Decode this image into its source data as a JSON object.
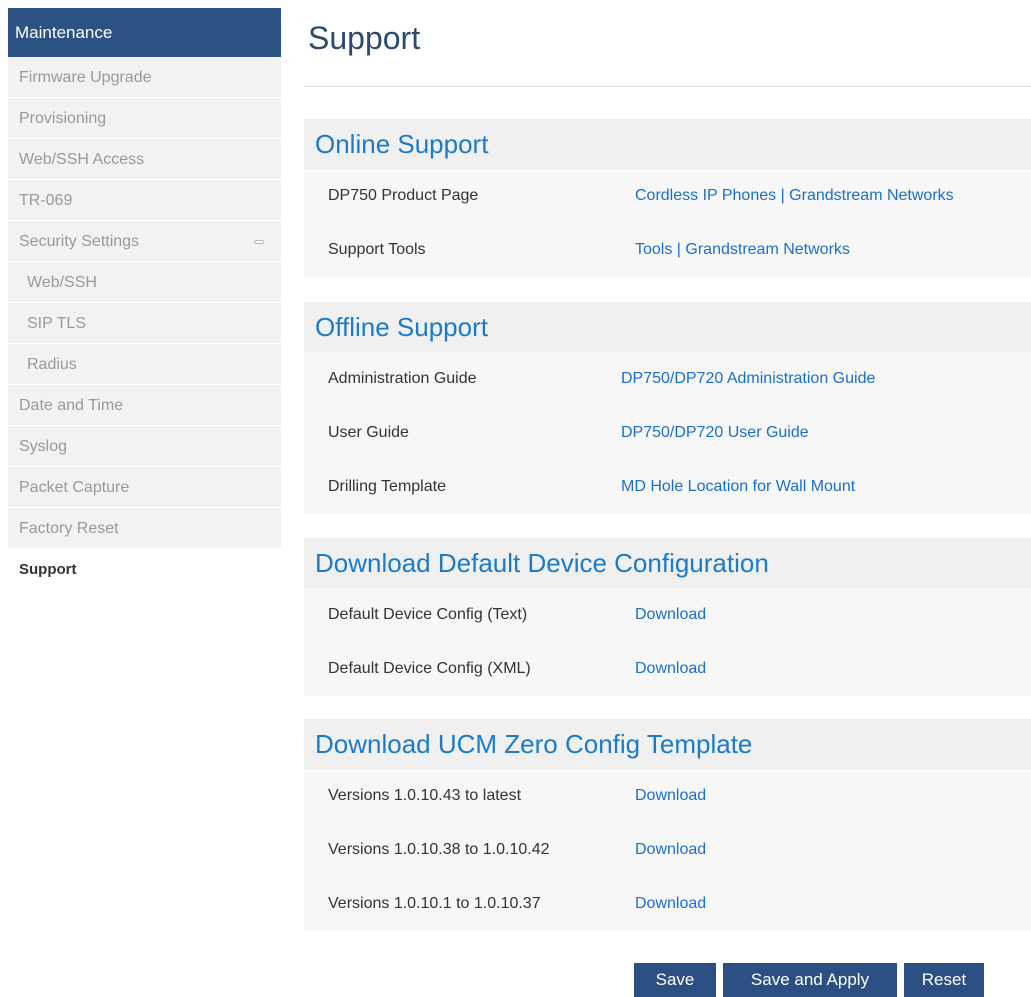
{
  "sidebar": {
    "header": "Maintenance",
    "items": [
      {
        "label": "Firmware Upgrade"
      },
      {
        "label": "Provisioning"
      },
      {
        "label": "Web/SSH Access"
      },
      {
        "label": "TR-069"
      },
      {
        "label": "Security Settings",
        "icon": "collapse-icon"
      },
      {
        "label": "Web/SSH"
      },
      {
        "label": "SIP TLS"
      },
      {
        "label": "Radius"
      },
      {
        "label": "Date and Time"
      },
      {
        "label": "Syslog"
      },
      {
        "label": "Packet Capture"
      },
      {
        "label": "Factory Reset"
      },
      {
        "label": "Support"
      }
    ]
  },
  "page": {
    "title": "Support"
  },
  "sections": {
    "online": {
      "title": "Online Support",
      "rows": [
        {
          "label": "DP750 Product Page",
          "link": "Cordless IP Phones | Grandstream Networks"
        },
        {
          "label": "Support Tools",
          "link": "Tools | Grandstream Networks"
        }
      ]
    },
    "offline": {
      "title": "Offline Support",
      "rows": [
        {
          "label": "Administration Guide",
          "link": "DP750/DP720 Administration Guide"
        },
        {
          "label": "User Guide",
          "link": "DP750/DP720 User Guide"
        },
        {
          "label": "Drilling Template",
          "link": "MD Hole Location for Wall Mount"
        }
      ]
    },
    "default_config": {
      "title": "Download Default Device Configuration",
      "rows": [
        {
          "label": "Default Device Config (Text)",
          "link": "Download"
        },
        {
          "label": "Default Device Config (XML)",
          "link": "Download"
        }
      ]
    },
    "ucm": {
      "title": "Download UCM Zero Config Template",
      "rows": [
        {
          "label": "Versions 1.0.10.43 to latest",
          "link": "Download"
        },
        {
          "label": "Versions 1.0.10.38 to 1.0.10.42",
          "link": "Download"
        },
        {
          "label": "Versions 1.0.10.1 to 1.0.10.37",
          "link": "Download"
        }
      ]
    }
  },
  "buttons": {
    "save": "Save",
    "save_apply": "Save and Apply",
    "reset": "Reset"
  },
  "colors": {
    "header_bg": "#2b5283",
    "link": "#1b6fcc",
    "section_title": "#1b7bc9",
    "button_bg": "#2c4f83"
  }
}
